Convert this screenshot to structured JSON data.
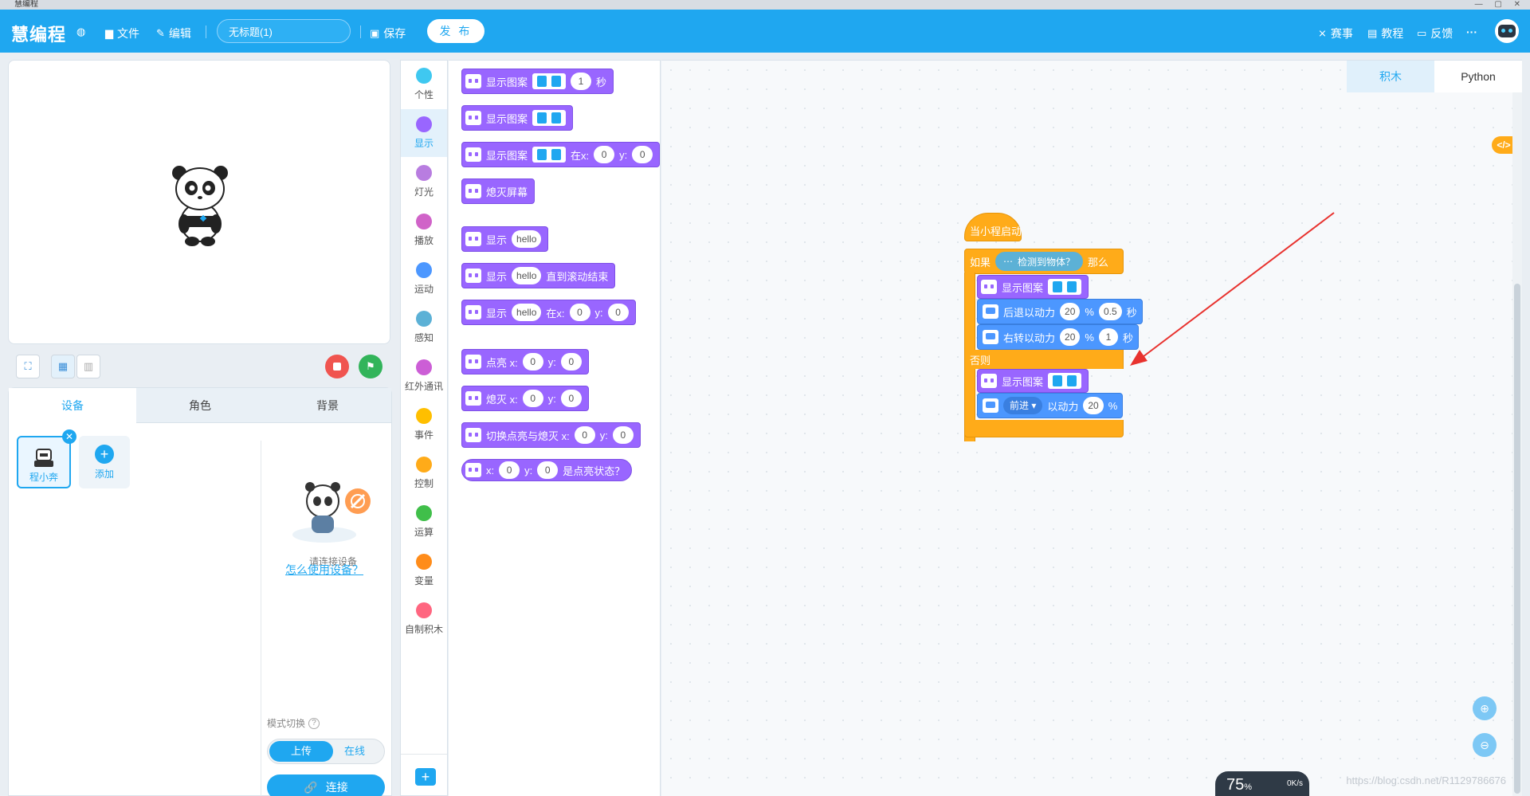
{
  "window": {
    "title": "慧编程"
  },
  "topbar": {
    "logo": "慧编程",
    "file": "文件",
    "edit": "编辑",
    "project_name": "无标题(1)",
    "save": "保存",
    "publish": "发 布",
    "contest": "赛事",
    "tutorial": "教程",
    "feedback": "反馈",
    "more": "···"
  },
  "panel": {
    "tabs": [
      "设备",
      "角色",
      "背景"
    ],
    "device_name": "程小奔",
    "add_label": "添加",
    "connect_hint": "请连接设备",
    "how_link": "怎么使用设备？",
    "mode_label": "模式切换",
    "mode_upload": "上传",
    "mode_online": "在线",
    "connect": "连接"
  },
  "categories": [
    {
      "label": "个性",
      "color": "#3fc8f0"
    },
    {
      "label": "显示",
      "color": "#9966ff"
    },
    {
      "label": "灯光",
      "color": "#b87de0"
    },
    {
      "label": "播放",
      "color": "#d063c8"
    },
    {
      "label": "运动",
      "color": "#4c97ff"
    },
    {
      "label": "感知",
      "color": "#5cb1d6"
    },
    {
      "label": "红外通讯",
      "color": "#cc5ed6"
    },
    {
      "label": "事件",
      "color": "#ffbf00"
    },
    {
      "label": "控制",
      "color": "#ffab19"
    },
    {
      "label": "运算",
      "color": "#40bf4a"
    },
    {
      "label": "变量",
      "color": "#ff8c1a"
    },
    {
      "label": "自制积木",
      "color": "#ff6680"
    }
  ],
  "palette": {
    "b1": {
      "text": "显示图案",
      "v1": "1",
      "unit": "秒"
    },
    "b2": {
      "text": "显示图案"
    },
    "b3": {
      "text": "显示图案",
      "at": "在x:",
      "x": "0",
      "ylab": "y:",
      "y": "0"
    },
    "b4": {
      "text": "熄灭屏幕"
    },
    "b5": {
      "text": "显示",
      "v": "hello"
    },
    "b6": {
      "text": "显示",
      "v": "hello",
      "tail": "直到滚动结束"
    },
    "b7": {
      "text": "显示",
      "v": "hello",
      "at": "在x:",
      "x": "0",
      "ylab": "y:",
      "y": "0"
    },
    "b8": {
      "text": "点亮 x:",
      "x": "0",
      "ylab": "y:",
      "y": "0"
    },
    "b9": {
      "text": "熄灭 x:",
      "x": "0",
      "ylab": "y:",
      "y": "0"
    },
    "b10": {
      "text": "切换点亮与熄灭 x:",
      "x": "0",
      "ylab": "y:",
      "y": "0"
    },
    "b11": {
      "text": "x:",
      "x": "0",
      "ylab": "y:",
      "y": "0",
      "tail": "是点亮状态？"
    }
  },
  "workspace": {
    "tab_blocks": "积木",
    "tab_python": "Python",
    "code_toggle": "</>",
    "script": {
      "hat": "当小程启动",
      "if": "如果",
      "condition": "检测到物体？",
      "then": "那么",
      "s1": "显示图案",
      "s2": {
        "text": "后退以动力",
        "power": "20",
        "pct": "%",
        "secs": "0.5",
        "unit": "秒"
      },
      "s3": {
        "text": "右转以动力",
        "power": "20",
        "pct": "%",
        "secs": "1",
        "unit": "秒"
      },
      "else": "否则",
      "s4": "显示图案",
      "s5": {
        "dir": "前进 ▾",
        "text": "以动力",
        "power": "20",
        "pct": "%"
      }
    }
  },
  "overlay": {
    "speed": "75",
    "speed_unit": "%",
    "net": "0K/s",
    "watermark": "https://blog.csdn.net/R1129786676"
  },
  "colors": {
    "brand": "#1fa7f0",
    "looks": "#9966ff",
    "control": "#ffab19",
    "motion": "#4c97ff",
    "arrow": "#e8322e"
  }
}
